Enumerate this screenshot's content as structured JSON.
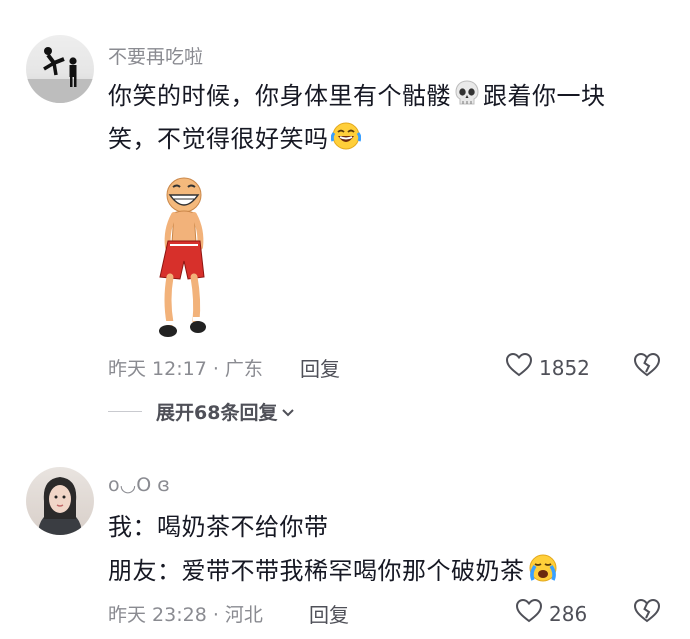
{
  "comments": [
    {
      "username": "不要再吃啦",
      "text_line1_a": "你笑的时候，你身体里有个骷髅",
      "text_line1_b": "跟着你一块",
      "text_line2": "笑，不觉得很好笑吗",
      "skull_emoji": "skull-icon",
      "laugh_emoji": "laugh-crying-icon",
      "has_sticker": true,
      "meta": "昨天 12:17 · 广东",
      "reply_label": "回复",
      "likes": "1852",
      "expand_label": "展开68条回复"
    },
    {
      "username": "o◡O ɞ",
      "text_line1": "我：喝奶茶不给你带",
      "text_line2": "朋友：爱带不带我稀罕喝你那个破奶茶",
      "cry_emoji": "crying-icon",
      "meta": "昨天 23:28 · 河北",
      "reply_label": "回复",
      "likes": "286"
    }
  ]
}
